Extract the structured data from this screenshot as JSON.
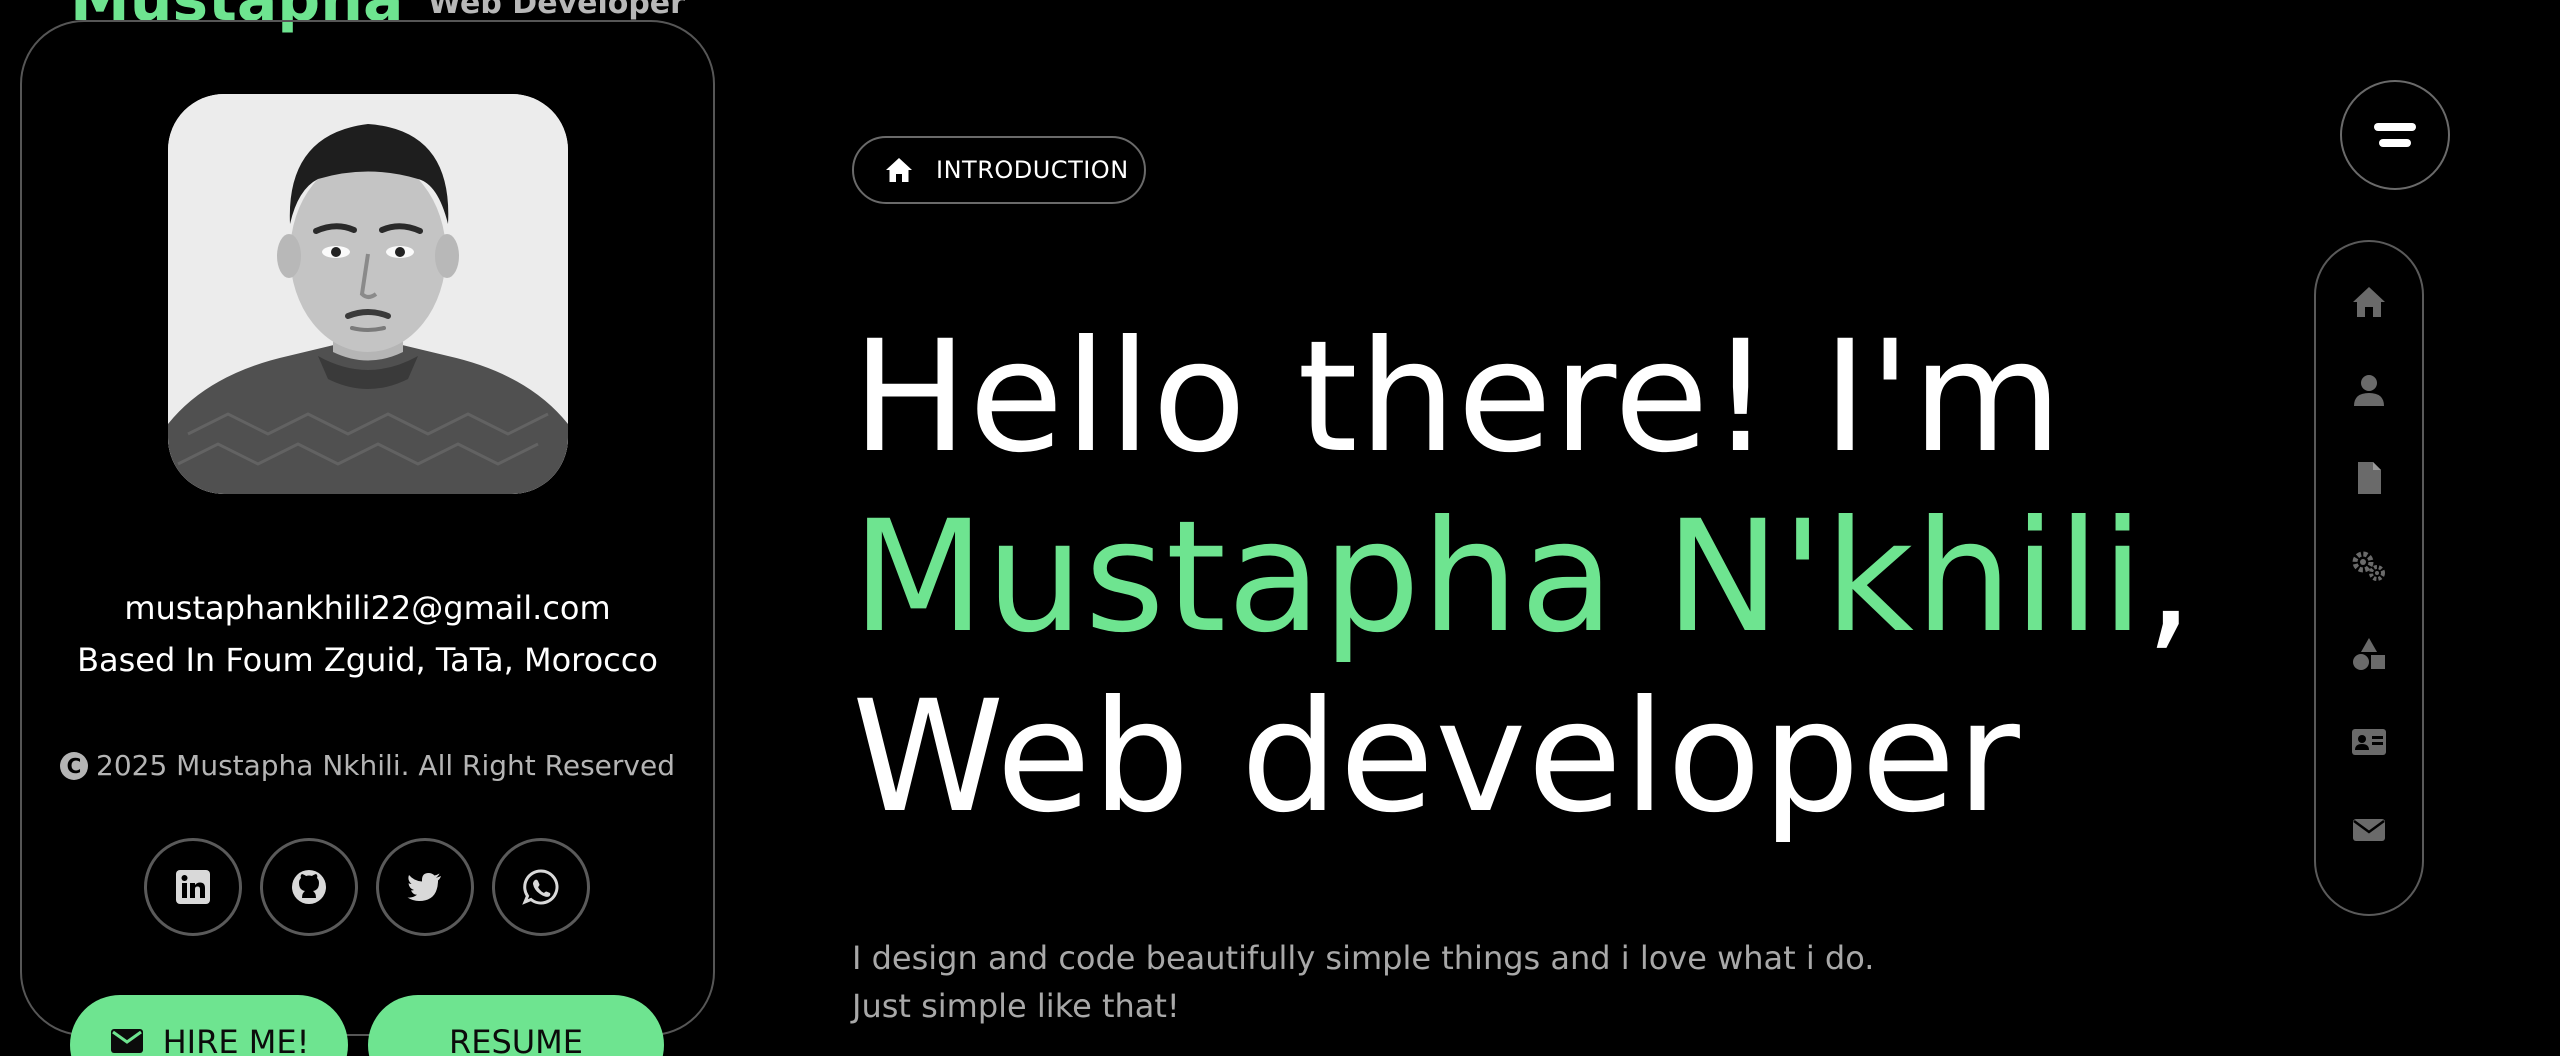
{
  "header": {
    "name": "Mustapha",
    "role": "Web Developer"
  },
  "profile": {
    "email": "mustaphankhili22@gmail.com",
    "location": "Based In Foum Zguid, TaTa, Morocco",
    "copyright": "2025 Mustapha Nkhili. All Right Reserved",
    "socials": [
      "linkedin-icon",
      "github-icon",
      "twitter-icon",
      "whatsapp-icon"
    ],
    "hire_label": "HIRE ME!",
    "resume_label": "RESUME"
  },
  "main": {
    "section_label": "INTRODUCTION",
    "heading_line1": "Hello there! I'm",
    "heading_name": "Mustapha N'khili",
    "heading_comma": ",",
    "heading_line3": "Web developer",
    "description_line1": "I design and code beautifully simple things and i love what i do.",
    "description_line2": "Just simple like that!"
  },
  "nav": {
    "items": [
      "home-icon",
      "user-icon",
      "file-icon",
      "gears-icon",
      "shapes-icon",
      "id-card-icon",
      "envelope-icon"
    ]
  },
  "colors": {
    "accent": "#6ee490",
    "background": "#000000",
    "muted_text": "#a8a8a8",
    "border": "#5a5a5a"
  }
}
